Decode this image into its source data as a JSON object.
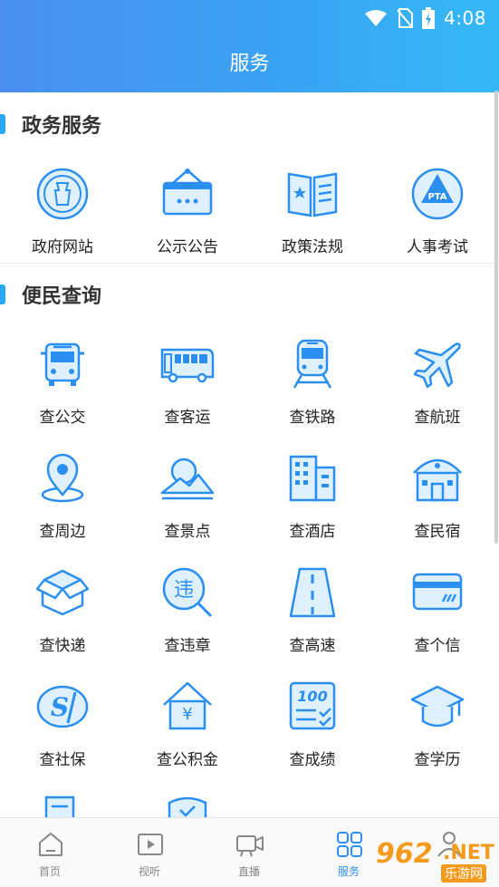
{
  "status_bar": {
    "time": "4:08"
  },
  "header": {
    "title": "服务"
  },
  "sections": [
    {
      "title": "政务服务",
      "items": [
        {
          "label": "政府网站",
          "icon": "government-emblem-icon"
        },
        {
          "label": "公示公告",
          "icon": "notice-board-icon"
        },
        {
          "label": "政策法规",
          "icon": "policy-book-icon"
        },
        {
          "label": "人事考试",
          "icon": "pta-exam-icon"
        }
      ]
    },
    {
      "title": "便民查询",
      "items": [
        {
          "label": "查公交",
          "icon": "bus-icon"
        },
        {
          "label": "查客运",
          "icon": "coach-icon"
        },
        {
          "label": "查铁路",
          "icon": "train-icon"
        },
        {
          "label": "查航班",
          "icon": "airplane-icon"
        },
        {
          "label": "查周边",
          "icon": "location-pin-icon"
        },
        {
          "label": "查景点",
          "icon": "scenery-icon"
        },
        {
          "label": "查酒店",
          "icon": "hotel-icon"
        },
        {
          "label": "查民宿",
          "icon": "homestay-icon"
        },
        {
          "label": "查快递",
          "icon": "package-icon"
        },
        {
          "label": "查违章",
          "icon": "violation-search-icon"
        },
        {
          "label": "查高速",
          "icon": "highway-icon"
        },
        {
          "label": "查个信",
          "icon": "credit-card-icon"
        },
        {
          "label": "查社保",
          "icon": "social-security-icon"
        },
        {
          "label": "查公积金",
          "icon": "housing-fund-icon"
        },
        {
          "label": "查成绩",
          "icon": "score-icon"
        },
        {
          "label": "查学历",
          "icon": "graduation-cap-icon"
        }
      ]
    }
  ],
  "tabbar": [
    {
      "label": "首页",
      "icon": "home-icon",
      "active": false
    },
    {
      "label": "视听",
      "icon": "video-icon",
      "active": false
    },
    {
      "label": "直播",
      "icon": "live-camera-icon",
      "active": false
    },
    {
      "label": "服务",
      "icon": "grid-icon",
      "active": true
    },
    {
      "label": "",
      "icon": "profile-icon",
      "active": false
    }
  ],
  "watermark": {
    "number": "962",
    "suffix": ".NET",
    "site": "乐游网"
  },
  "colors": {
    "accent": "#2a8ff0",
    "header_start": "#4a8ff0",
    "header_end": "#35b9f6",
    "icon_fill": "#dff0ff"
  }
}
